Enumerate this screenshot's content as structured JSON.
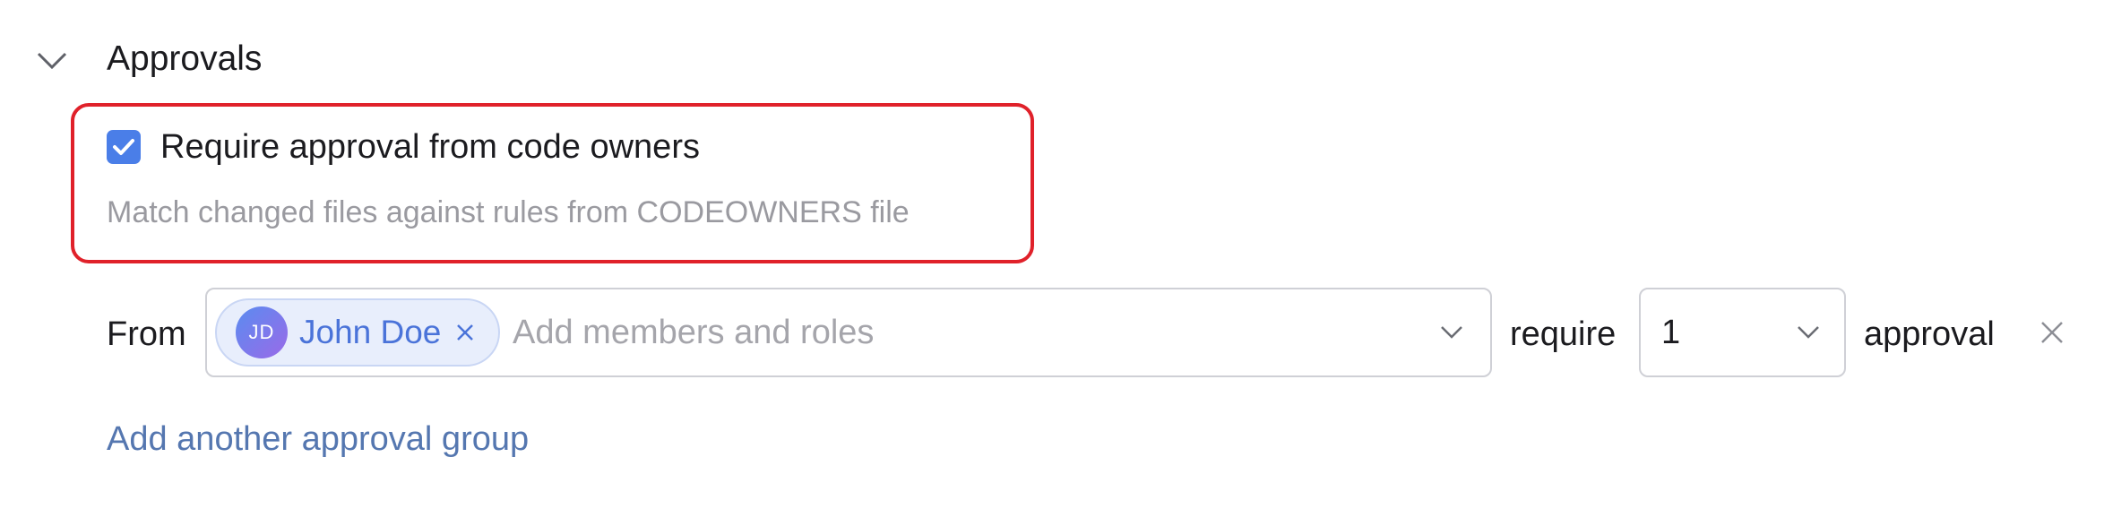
{
  "section": {
    "title": "Approvals",
    "collapse_icon": "chevron-down-icon"
  },
  "code_owners": {
    "checked": true,
    "label": "Require approval from code owners",
    "hint": "Match changed files against rules from CODEOWNERS file",
    "highlight_color": "#e0212a"
  },
  "approval_group": {
    "from_label": "From",
    "members": [
      {
        "initials": "JD",
        "name": "John Doe",
        "remove_symbol": "×"
      }
    ],
    "members_placeholder": "Add members and roles",
    "require_label": "require",
    "count_value": "1",
    "approval_label": "approval",
    "remove_icon": "close-icon"
  },
  "add_group_link": "Add another approval group",
  "colors": {
    "accent": "#4a7ee8",
    "link": "#5577b0",
    "chip_bg": "#e8eefc",
    "chip_text": "#4a73d9"
  }
}
